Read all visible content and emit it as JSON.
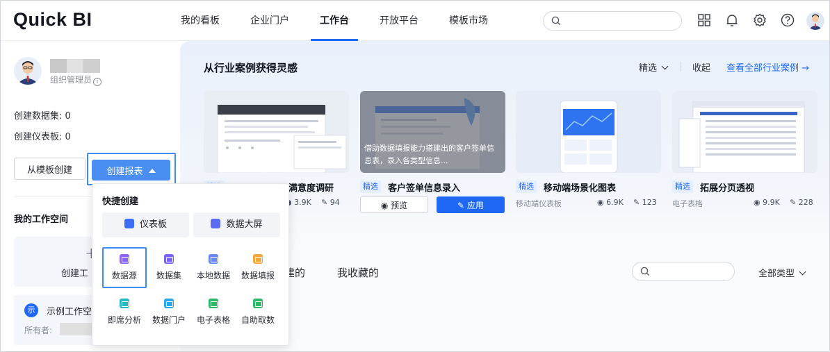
{
  "app": {
    "logo": "Quick BI"
  },
  "nav": [
    {
      "label": "我的看板",
      "active": false
    },
    {
      "label": "企业门户",
      "active": false
    },
    {
      "label": "工作台",
      "active": true
    },
    {
      "label": "开放平台",
      "active": false
    },
    {
      "label": "模板市场",
      "active": false
    }
  ],
  "header": {
    "search_placeholder": ""
  },
  "sidebar": {
    "role": "组织管理员",
    "stats": [
      "创建数据集: 0",
      "创建仪表板: 0"
    ],
    "from_template_label": "从模板创建",
    "create_report_label": "创建报表",
    "workspace_title": "我的工作空间",
    "create_workspace_label": "创建工",
    "example_workspace": {
      "badge": "示",
      "title": "示例工作空",
      "owner_label": "所有者:"
    }
  },
  "inspiration": {
    "title": "从行业案例获得灵感",
    "featured_label": "精选",
    "collapse_label": "收起",
    "view_all_label": "查看全部行业案例 →",
    "cards": [
      {
        "tag": "精选",
        "title": "满意度调研",
        "type": "",
        "views": "3.9K",
        "edits": "94"
      },
      {
        "tag": "精选",
        "title": "客户签单信息录入",
        "overlay": "借助数据填报能力搭建出的客户签单信息表，录入各类型信息...",
        "preview_label": "预览",
        "apply_label": "应用"
      },
      {
        "tag": "精选",
        "title": "移动端场景化图表",
        "type": "移动端仪表板",
        "views": "6.9K",
        "edits": "123"
      },
      {
        "tag": "精选",
        "title": "拓展分页透视",
        "type": "电子表格",
        "views": "9.9K",
        "edits": "228"
      }
    ]
  },
  "list": {
    "tabs": [
      "建的",
      "我收藏的"
    ],
    "all_types_label": "全部类型"
  },
  "create_menu": {
    "title": "快捷创建",
    "primary": [
      {
        "label": "仪表板",
        "color": "#3b6ef5"
      },
      {
        "label": "数据大屏",
        "color": "#5b6cf0"
      }
    ],
    "items": [
      {
        "label": "数据源",
        "color": "#8d63f2"
      },
      {
        "label": "数据集",
        "color": "#7a63f0"
      },
      {
        "label": "本地数据",
        "color": "#6a88f5"
      },
      {
        "label": "数据填报",
        "color": "#f3a63a"
      },
      {
        "label": "即席分析",
        "color": "#27b9c4"
      },
      {
        "label": "数据门户",
        "color": "#2aa8e8"
      },
      {
        "label": "电子表格",
        "color": "#2fb86a"
      },
      {
        "label": "自助取数",
        "color": "#2fb86a"
      }
    ]
  }
}
